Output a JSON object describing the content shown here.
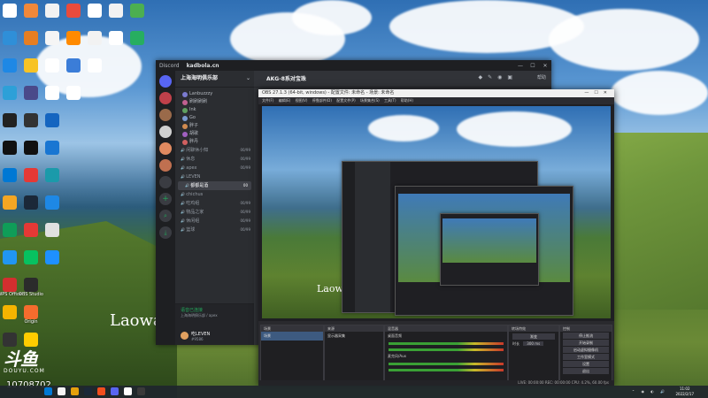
{
  "desktop": {
    "wallpaper_text": "Laowa",
    "icons": [
      {
        "label": "",
        "color": "#ffffff"
      },
      {
        "label": "",
        "color": "#f0883a"
      },
      {
        "label": "",
        "color": "#f2f2f2"
      },
      {
        "label": "",
        "color": "#e94b3c"
      },
      {
        "label": "",
        "color": "#ffffff"
      },
      {
        "label": "",
        "color": "#f2f2f2"
      },
      {
        "label": "",
        "color": "#4caf50"
      },
      {
        "label": "",
        "color": "#2f8fd8"
      },
      {
        "label": "",
        "color": "#e67e22"
      },
      {
        "label": "",
        "color": "#f5f5f5"
      },
      {
        "label": "",
        "color": "#ff8a00"
      },
      {
        "label": "",
        "color": "#f2f2f2"
      },
      {
        "label": "",
        "color": "#ffffff"
      },
      {
        "label": "",
        "color": "#27ae60"
      },
      {
        "label": "",
        "color": "#1e88e5"
      },
      {
        "label": "",
        "color": "#f7c325"
      },
      {
        "label": "",
        "color": "#ffffff"
      },
      {
        "label": "",
        "color": "#3b7dd8"
      },
      {
        "label": "",
        "color": "#ffffff"
      },
      {
        "label": "",
        "color": "#2da0d8"
      },
      {
        "label": "",
        "color": "#4a4a8a"
      },
      {
        "label": "",
        "color": "#ffffff"
      },
      {
        "label": "",
        "color": "#ffffff"
      },
      {
        "label": "",
        "color": "#222222"
      },
      {
        "label": "",
        "color": "#333333"
      },
      {
        "label": "",
        "color": "#1565c0"
      },
      {
        "label": "",
        "color": "#111111"
      },
      {
        "label": "",
        "color": "#111111"
      },
      {
        "label": "",
        "color": "#1976d2"
      },
      {
        "label": "",
        "color": "#0078d4"
      },
      {
        "label": "",
        "color": "#e53935"
      },
      {
        "label": "",
        "color": "#1b9aaa"
      },
      {
        "label": "",
        "color": "#f5a623"
      },
      {
        "label": "",
        "color": "#1b2838"
      },
      {
        "label": "",
        "color": "#1e88e5"
      },
      {
        "label": "",
        "color": "#0f9d58"
      },
      {
        "label": "",
        "color": "#e53935"
      },
      {
        "label": "",
        "color": "#e0e0e0"
      },
      {
        "label": "",
        "color": "#2196f3"
      },
      {
        "label": "",
        "color": "#07c160"
      },
      {
        "label": "",
        "color": "#1e90ff"
      },
      {
        "label": "WPS Office",
        "color": "#d32f2f"
      },
      {
        "label": "OBS Studio",
        "color": "#2b2b2b"
      },
      {
        "label": "",
        "color": "#f5b400"
      },
      {
        "label": "Origin",
        "color": "#f56c2d"
      },
      {
        "label": "",
        "color": "#333333"
      },
      {
        "label": "",
        "color": "#ffcc00"
      }
    ],
    "watermark_logo": "斗鱼",
    "watermark_sub": "DOUYU.COM",
    "room_number": "10708702"
  },
  "discord": {
    "titlebar_left": "Discord",
    "titlebar_title": "kadbola.cn",
    "server_name": "上海海明俱乐部",
    "channel_header": "AKG-8系对宝珠",
    "help_label": "帮助",
    "voice_users": [
      {
        "name": "Lanbuzzzy",
        "color": "#7b7bd0"
      },
      {
        "name": "刷刷刷刷",
        "color": "#c06090"
      },
      {
        "name": "Ink",
        "color": "#5fa05f"
      },
      {
        "name": "Go",
        "color": "#7a9ad0"
      },
      {
        "name": "胖子",
        "color": "#d08a50"
      },
      {
        "name": "胡歌",
        "color": "#a060c0"
      },
      {
        "name": "胖丹",
        "color": "#d06060"
      }
    ],
    "channels": [
      {
        "name": "闲聊休小知",
        "count": "00/99"
      },
      {
        "name": "休息",
        "count": "00/99"
      },
      {
        "name": "apex",
        "count": "00/99"
      },
      {
        "name": "LEVEN",
        "count": ""
      },
      {
        "name": "都都是酒",
        "count": "00"
      },
      {
        "name": "chichus",
        "count": ""
      },
      {
        "name": "吃鸡组",
        "count": "00/99"
      },
      {
        "name": "物品之家",
        "count": "00/99"
      },
      {
        "name": "休闲组",
        "count": "00/99"
      },
      {
        "name": "篮球",
        "count": "00/99"
      }
    ],
    "voice_status": "语音已连接",
    "voice_sub": "上海海明俱乐部 / apex",
    "user_name": "吃LEVEN",
    "user_status": "#9586"
  },
  "obs": {
    "title": "OBS 27.1.3 (64-bit, windows) - 配置文件: 未命名 - 场景: 未命名",
    "menu": "文件(F) 编辑(E) 视图(V) 停靠部件(D) 配置文件(P) 场景集合(S) 工具(T) 帮助(H)",
    "docks": {
      "scenes": "场景",
      "sources": "来源",
      "mixer": "混音器",
      "transitions": "转场特效",
      "controls": "控制"
    },
    "scene_item": "场景",
    "source_item": "显示器采集",
    "mixer_tracks": [
      {
        "name": "桌面音频",
        "db": "0.0 dB"
      },
      {
        "name": "麦克风/Aux",
        "db": "0.0 dB"
      }
    ],
    "transition_label": "渐变",
    "duration_label": "时长",
    "duration_value": "300 ms",
    "controls": [
      "停止推流",
      "开始录制",
      "启动虚拟摄像机",
      "工作室模式",
      "设置",
      "退出"
    ],
    "status_text": "LIVE: 00:00:00  REC: 00:00:00  CPU: 4.2%, 60.00 fps"
  },
  "taskbar": {
    "icons": [
      "#0078d4",
      "#f5f5f5",
      "#e5a00d",
      "#1b2838",
      "#f24e1e",
      "#5865f2",
      "#ffffff",
      "#3a3a3a"
    ],
    "time": "11:02",
    "date": "2022/2/17"
  }
}
